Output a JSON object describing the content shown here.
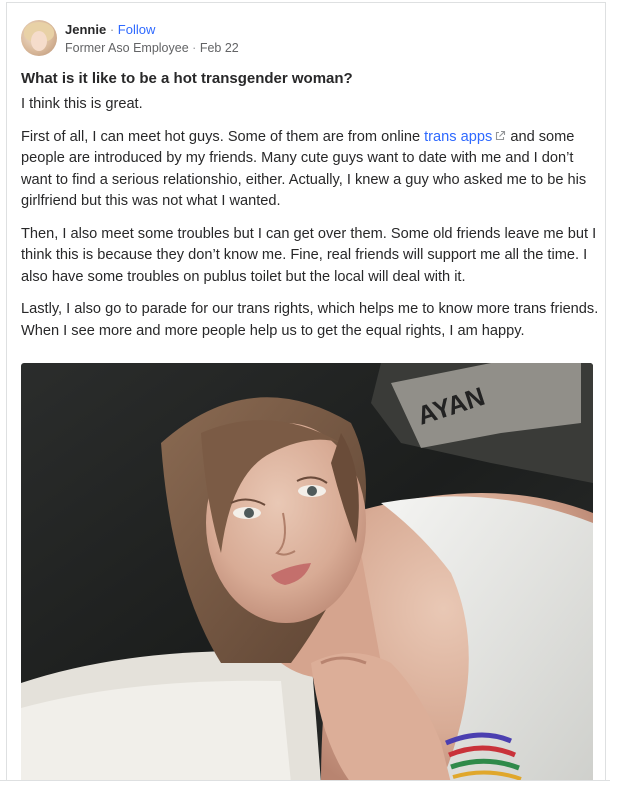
{
  "author": {
    "name": "Jennie",
    "separator": "·",
    "follow_label": "Follow",
    "credential": "Former Aso Employee",
    "date": "Feb 22"
  },
  "question": {
    "title": "What is it like to be a hot transgender woman?"
  },
  "answer": {
    "p1": "I think this is great.",
    "p2_before": "First of all, I can meet hot guys. Some of them are from online ",
    "p2_link": "trans apps",
    "p2_after": " and some people are introduced by my friends. Many cute guys want to date with me and I don’t want to find a serious relationshio, either. Actually, I knew a guy who asked me to be his girlfriend but this was not what I wanted.",
    "p3": "Then, I also meet some troubles but I can get over them. Some old friends leave me but I think this is because they don’t know me. Fine, real friends will support me all the time. I also have some troubles on publus toilet but the local will deal with it.",
    "p4": "Lastly, I also go to parade for our trans rights, which helps me to know more trans friends. When I see more and more people help us to get the equal rights, I am happy."
  },
  "icons": {
    "external_link": "external-link-icon"
  },
  "colors": {
    "link": "#2e69ff",
    "text": "#282829",
    "muted": "#636466"
  }
}
